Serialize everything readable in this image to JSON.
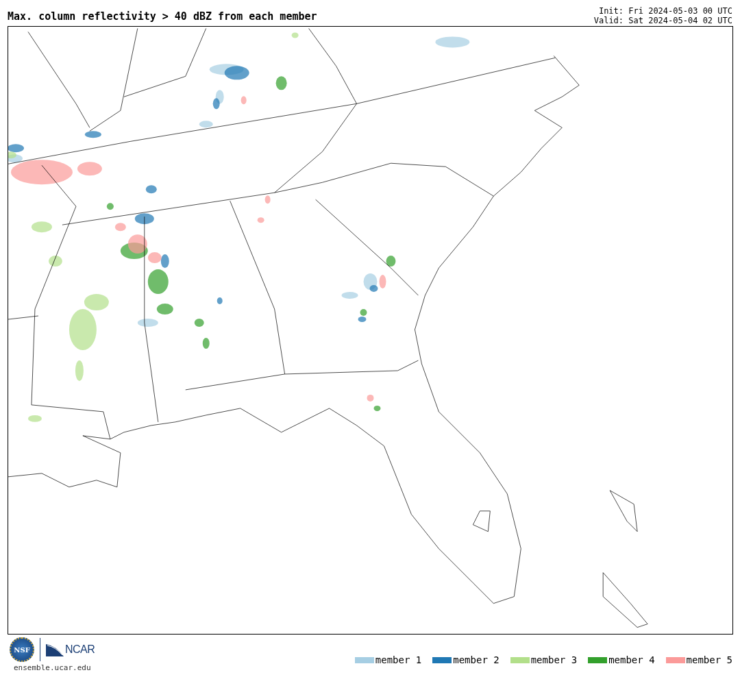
{
  "title": "Max. column reflectivity > 40 dBZ from each member",
  "init": "Init: Fri 2024-05-03 00 UTC",
  "valid": "Valid: Sat 2024-05-04 02 UTC",
  "logos": {
    "nsf": "NSF",
    "ncar": "NCAR",
    "website": "ensemble.ucar.edu"
  },
  "legend": [
    {
      "label": "member 1",
      "color": "#a6cee3"
    },
    {
      "label": "member 2",
      "color": "#1f78b4"
    },
    {
      "label": "member 3",
      "color": "#b2df8a"
    },
    {
      "label": "member 4",
      "color": "#33a02c"
    },
    {
      "label": "member 5",
      "color": "#fb9a99"
    }
  ]
}
